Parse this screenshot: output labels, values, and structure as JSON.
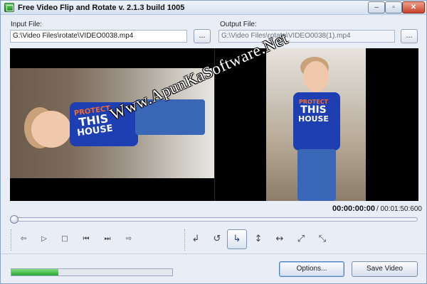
{
  "window": {
    "title": "Free Video Flip and Rotate  v. 2.1.3 build 1005",
    "minimize_glyph": "–",
    "maximize_glyph": "▫",
    "close_glyph": "✕"
  },
  "input": {
    "label": "Input File:",
    "value": "G:\\Video Files\\rotate\\VIDEO0038.mp4",
    "browse_label": "..."
  },
  "output": {
    "label": "Output File:",
    "value": "G:\\Video Files\\rotate\\VIDEO0038(1).mp4",
    "browse_label": "..."
  },
  "preview": {
    "shirt_line1": "PROTECT",
    "shirt_line2": "THIS",
    "shirt_line3": "HOUSE",
    "watermark": "Www.ApunKaSoftware.Net"
  },
  "time": {
    "current": "00:00:00:00",
    "total": "/ 00:01:50:600"
  },
  "seek": {
    "position": 0.0
  },
  "playback_controls": [
    {
      "name": "rewind-icon",
      "glyph": "⇦"
    },
    {
      "name": "play-icon",
      "glyph": "▷"
    },
    {
      "name": "stop-icon",
      "glyph": "□"
    },
    {
      "name": "previous-frame-icon",
      "glyph": "⏮"
    },
    {
      "name": "next-frame-icon",
      "glyph": "⏭"
    },
    {
      "name": "forward-icon",
      "glyph": "⇨"
    }
  ],
  "transform_controls": [
    {
      "name": "rotate-left-icon",
      "glyph": "↲",
      "active": false
    },
    {
      "name": "rotate-180-icon",
      "glyph": "↺",
      "active": false
    },
    {
      "name": "rotate-right-icon",
      "glyph": "↳",
      "active": true
    },
    {
      "name": "flip-vertical-icon",
      "glyph": "↕",
      "active": false
    },
    {
      "name": "flip-horizontal-icon",
      "glyph": "↔",
      "active": false
    },
    {
      "name": "transpose-icon",
      "glyph": "⤢",
      "active": false
    },
    {
      "name": "transverse-icon",
      "glyph": "⤡",
      "active": false
    }
  ],
  "progress": {
    "fraction": 0.29
  },
  "buttons": {
    "options": "Options...",
    "save": "Save Video"
  }
}
